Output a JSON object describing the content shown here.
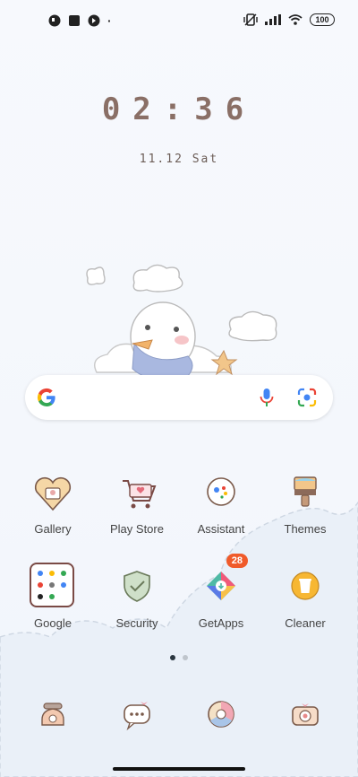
{
  "status_bar": {
    "left_icons": [
      "notification-icon-1",
      "notification-icon-2",
      "notification-icon-3"
    ],
    "dot": "·",
    "right_icons": [
      "vibrate-icon",
      "signal-icon",
      "wifi-icon"
    ],
    "battery": "100"
  },
  "clock": {
    "time": "02:36",
    "date": "11.12 Sat"
  },
  "search_bar": {
    "mic_icon": "mic-icon",
    "lens_icon": "lens-icon"
  },
  "apps_row1": [
    {
      "label": "Gallery",
      "icon": "gallery-icon"
    },
    {
      "label": "Play Store",
      "icon": "play-store-icon"
    },
    {
      "label": "Assistant",
      "icon": "assistant-icon"
    },
    {
      "label": "Themes",
      "icon": "themes-icon"
    }
  ],
  "apps_row2": [
    {
      "label": "Google",
      "icon": "google-folder-icon"
    },
    {
      "label": "Security",
      "icon": "security-icon"
    },
    {
      "label": "GetApps",
      "icon": "getapps-icon",
      "badge": "28"
    },
    {
      "label": "Cleaner",
      "icon": "cleaner-icon"
    }
  ],
  "dock": [
    {
      "icon": "phone-icon"
    },
    {
      "icon": "messages-icon"
    },
    {
      "icon": "browser-icon"
    },
    {
      "icon": "camera-icon"
    }
  ],
  "page_indicator": {
    "count": 2,
    "active": 0
  },
  "colors": {
    "accent": "#8a6f66",
    "badge": "#f05a2a"
  }
}
